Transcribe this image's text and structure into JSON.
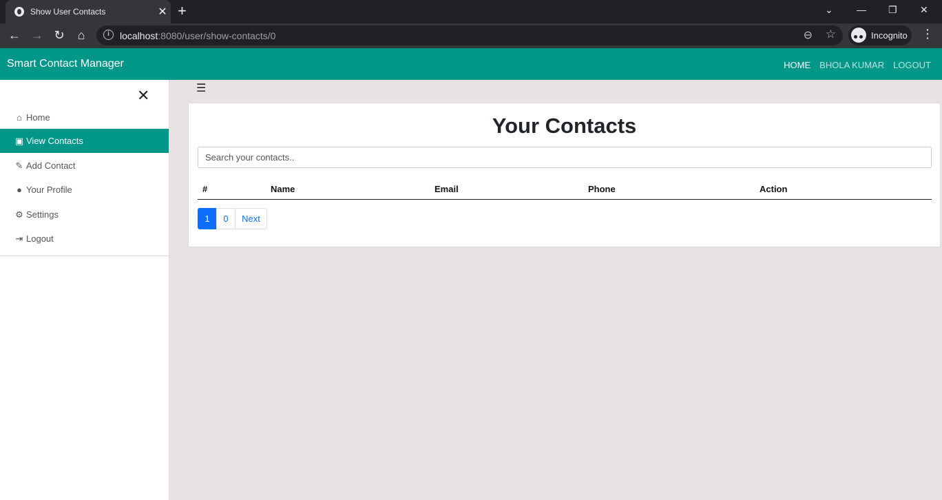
{
  "browser": {
    "tab_title": "Show User Contacts",
    "url_host": "localhost",
    "url_path": ":8080/user/show-contacts/0",
    "profile_label": "Incognito"
  },
  "navbar": {
    "brand": "Smart Contact Manager",
    "links": [
      {
        "label": "HOME",
        "active": true
      },
      {
        "label": "BHOLA KUMAR",
        "active": false
      },
      {
        "label": "LOGOUT",
        "active": false
      }
    ]
  },
  "sidebar": {
    "items": [
      {
        "label": "Home",
        "icon": "home-icon",
        "active": false
      },
      {
        "label": "View Contacts",
        "icon": "id-card-icon",
        "active": true
      },
      {
        "label": "Add Contact",
        "icon": "pencil-icon",
        "active": false
      },
      {
        "label": "Your Profile",
        "icon": "user-circle-icon",
        "active": false
      },
      {
        "label": "Settings",
        "icon": "cogs-icon",
        "active": false
      },
      {
        "label": "Logout",
        "icon": "sign-out-icon",
        "active": false
      }
    ]
  },
  "main": {
    "title": "Your Contacts",
    "search_placeholder": "Search your contacts..",
    "columns": [
      "#",
      "Name",
      "Email",
      "Phone",
      "Action"
    ],
    "pagination": {
      "pages": [
        "1",
        "0"
      ],
      "current": "1",
      "next_label": "Next"
    }
  },
  "colors": {
    "accent": "#009688",
    "link": "#0d6efd",
    "background": "#e8e3e3"
  }
}
